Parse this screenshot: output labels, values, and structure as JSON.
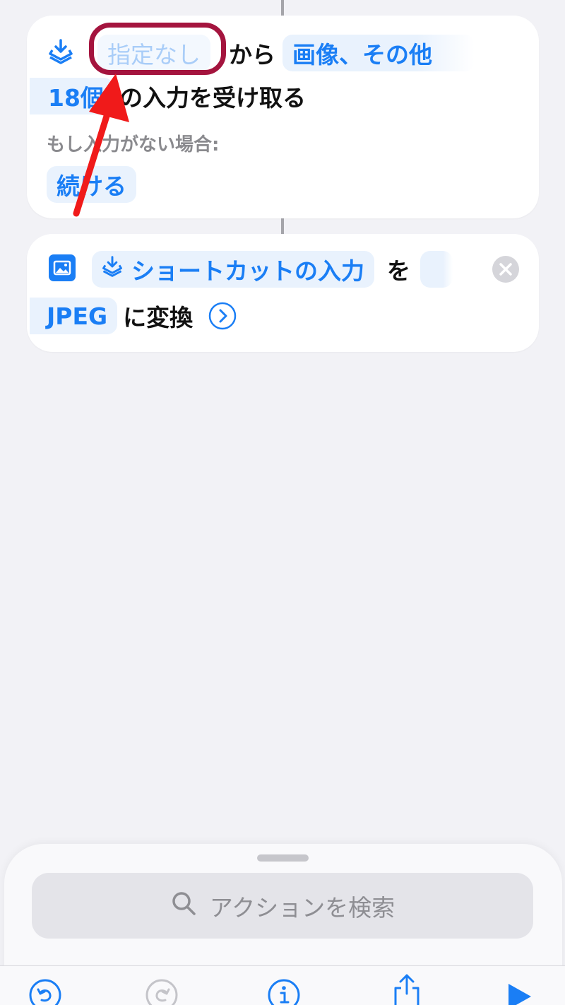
{
  "card1": {
    "icon": "shortcut-input-icon",
    "source_token": "指定なし",
    "from_text": "から",
    "type_token": "画像、その他",
    "count_token": "18個",
    "receive_text": "の入力を受け取る",
    "if_no_input_label": "もし入力がない場合:",
    "continue_token": "続ける"
  },
  "card2": {
    "icon": "photo-icon",
    "input_token": "ショートカットの入力",
    "wo_text": "を",
    "format_token": "JPEG",
    "convert_text": "に変換"
  },
  "search": {
    "placeholder": "アクションを検索"
  },
  "toolbar": {
    "icons": [
      "undo-icon",
      "redo-icon",
      "info-icon",
      "share-icon",
      "play-icon"
    ]
  },
  "colors": {
    "accent": "#1a7ef5",
    "token_bg": "#e9f2fd",
    "highlight": "#a4143e",
    "arrow": "#f01a1a"
  }
}
